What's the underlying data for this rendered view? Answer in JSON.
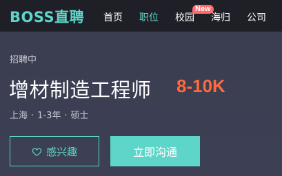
{
  "header": {
    "logo": "BOSS直聘",
    "nav": [
      {
        "label": "首页"
      },
      {
        "label": "职位",
        "active": true
      },
      {
        "label": "校园",
        "badge": "New"
      },
      {
        "label": "海归"
      },
      {
        "label": "公司"
      }
    ]
  },
  "job": {
    "status": "招聘中",
    "title": "增材制造工程师",
    "salary": "8-10K",
    "city": "上海",
    "experience": "1-3年",
    "degree": "硕士"
  },
  "actions": {
    "interest_label": "感兴趣",
    "chat_label": "立即沟通"
  },
  "colors": {
    "accent": "#5dd5c8",
    "salary": "#ff6a3d",
    "badge": "#ff6b6b",
    "header_bg": "#1f2027",
    "page_bg": "#3a3d4f"
  },
  "icons": {
    "interest": "heart-outline-icon"
  }
}
